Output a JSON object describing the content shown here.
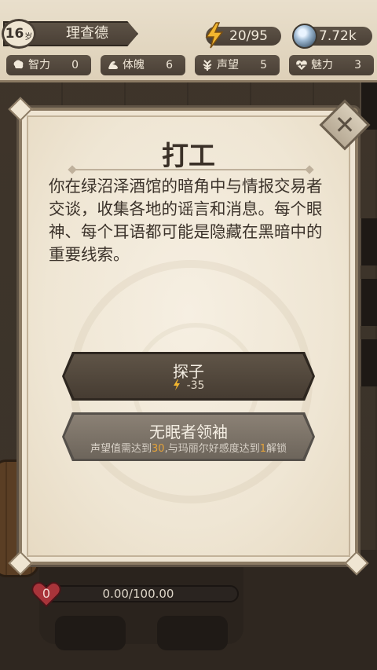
{
  "player": {
    "age": "16",
    "age_unit": "岁",
    "name": "理查德"
  },
  "resources": {
    "energy": "20/95",
    "gems": "7.72k"
  },
  "stats": [
    {
      "icon": "brain-icon",
      "label": "智力",
      "value": "0"
    },
    {
      "icon": "arm-icon",
      "label": "体魄",
      "value": "6"
    },
    {
      "icon": "laurel-icon",
      "label": "声望",
      "value": "5"
    },
    {
      "icon": "heart-pulse-icon",
      "label": "魅力",
      "value": "3"
    }
  ],
  "modal": {
    "title": "打工",
    "description": "你在绿沼泽酒馆的暗角中与情报交易者交谈，收集各地的谣言和消息。每个眼神、每个耳语都可能是隐藏在黑暗中的重要线索。",
    "choices": [
      {
        "label": "探子",
        "cost": "-35",
        "locked": false
      },
      {
        "label": "无眠者领袖",
        "locked": true,
        "req_a": "声望值需达到",
        "req_num1": "30",
        "req_b": ",与玛丽尔好感度达到",
        "req_num2": "1",
        "req_c": "解锁"
      }
    ]
  },
  "status": {
    "hp_value": "0",
    "hp_bar": "0.00/100.00",
    "progress_fraction": 0
  },
  "colors": {
    "accent": "#e3a23a",
    "panel": "#efe6d4",
    "dark_button": "#4f453a"
  }
}
